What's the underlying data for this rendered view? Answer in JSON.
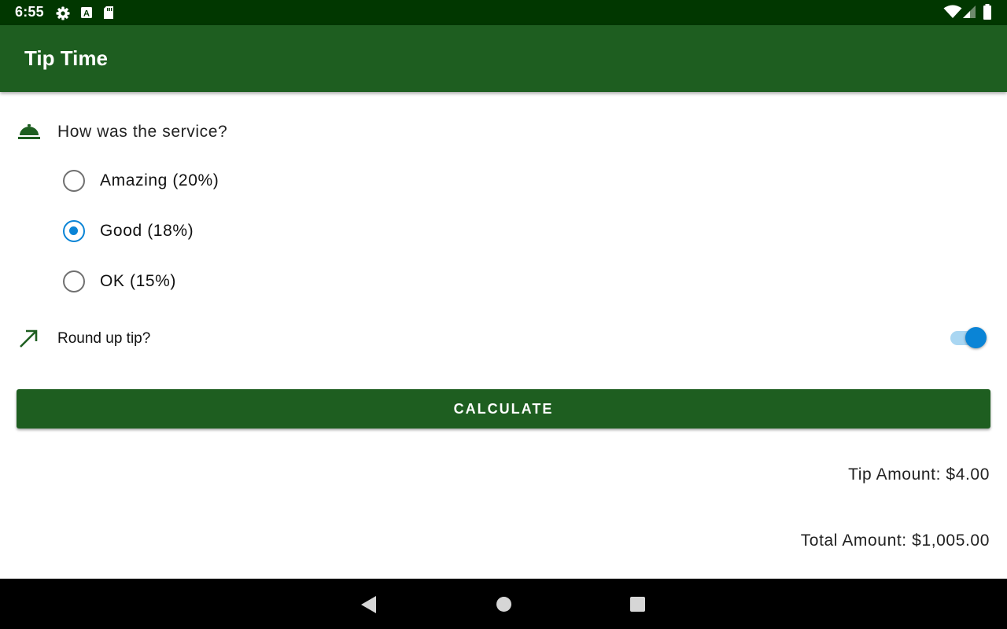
{
  "status_bar": {
    "time": "6:55",
    "left_icons": [
      "gear-icon",
      "a-icon",
      "sd-card-icon"
    ],
    "right_icons": [
      "wifi-icon",
      "signal-icon",
      "battery-icon"
    ]
  },
  "app_bar": {
    "title": "Tip Time",
    "color": "#1e5e20"
  },
  "service": {
    "icon": "room-service-icon",
    "question": "How was the service?",
    "options": [
      {
        "label": "Amazing (20%)",
        "selected": false
      },
      {
        "label": "Good (18%)",
        "selected": true
      },
      {
        "label": "OK (15%)",
        "selected": false
      }
    ]
  },
  "round_up": {
    "icon": "trending-up-icon",
    "label": "Round up tip?",
    "checked": true
  },
  "calculate_button": {
    "label": "CALCULATE"
  },
  "results": {
    "tip": "Tip Amount: $4.00",
    "total": "Total Amount: $1,005.00"
  },
  "nav_bar": {
    "buttons": [
      "back-icon",
      "home-icon",
      "recents-icon"
    ]
  },
  "colors": {
    "status_bar": "#013700",
    "primary": "#1e5e20",
    "accent": "#0a84d6",
    "switch_track": "#a9d6f2"
  }
}
